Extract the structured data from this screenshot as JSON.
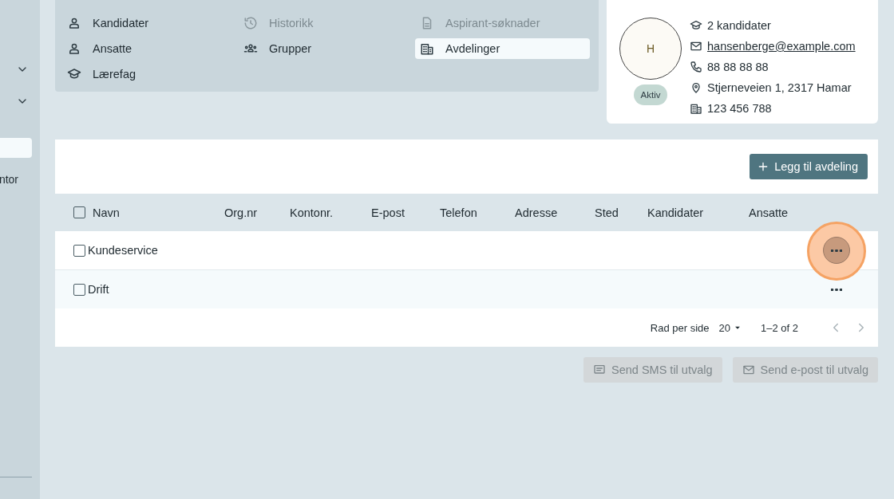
{
  "sidebar": {
    "groups": [
      {
        "expanded": false
      },
      {
        "expanded": false
      }
    ],
    "items": [
      {
        "selected": true
      },
      {
        "label": "ntor",
        "selected": false
      }
    ]
  },
  "nav": {
    "items": [
      {
        "label": "Kandidater",
        "disabled": false,
        "selected": false
      },
      {
        "label": "Historikk",
        "disabled": true,
        "selected": false
      },
      {
        "label": "Aspirant-søknader",
        "disabled": true,
        "selected": false
      },
      {
        "label": "Ansatte",
        "disabled": false,
        "selected": false
      },
      {
        "label": "Grupper",
        "disabled": false,
        "selected": false
      },
      {
        "label": "Avdelinger",
        "disabled": false,
        "selected": true
      },
      {
        "label": "Lærefag",
        "disabled": false,
        "selected": false
      }
    ]
  },
  "profile": {
    "initial": "H",
    "status": "Aktiv",
    "details": [
      {
        "kind": "text",
        "value": "2 kandidater"
      },
      {
        "kind": "link",
        "value": "hansenberge@example.com"
      },
      {
        "kind": "text",
        "value": "88 88 88 88"
      },
      {
        "kind": "text",
        "value": "Stjerneveien 1, 2317 Hamar"
      },
      {
        "kind": "text",
        "value": "123 456 788"
      }
    ]
  },
  "table": {
    "add_button": "Legg til avdeling",
    "select_all": {
      "checked": false
    },
    "columns": [
      "Navn",
      "Org.nr",
      "Kontonr.",
      "E-post",
      "Telefon",
      "Adresse",
      "Sted",
      "Kandidater",
      "Ansatte"
    ],
    "rows": [
      {
        "name": "Kundeservice",
        "checked": false,
        "highlighted": true
      },
      {
        "name": "Drift",
        "checked": false,
        "highlighted": false
      }
    ],
    "pagination": {
      "rows_per_page_label": "Rad per side",
      "rows_per_page": "20",
      "range": "1–2 of 2",
      "prev_disabled": true,
      "next_disabled": true
    }
  },
  "actions": [
    {
      "label": "Send SMS til utvalg",
      "disabled": true
    },
    {
      "label": "Send e-post til utvalg",
      "disabled": true
    }
  ]
}
